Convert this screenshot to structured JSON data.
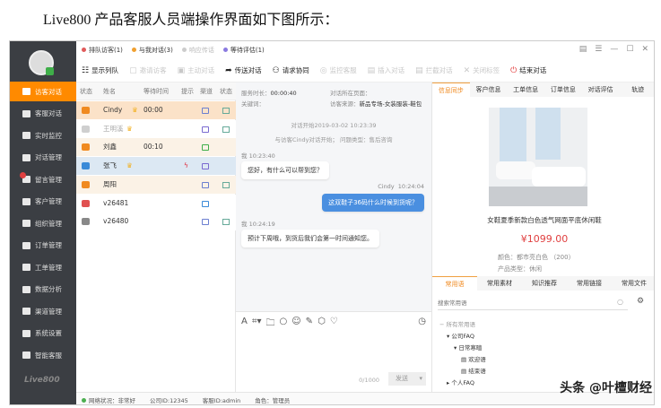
{
  "doc_title": "Live800 产品客服人员端操作界面如下图所示：",
  "sidebar": {
    "logo": "Live800",
    "items": [
      {
        "label": "访客对话",
        "active": true
      },
      {
        "label": "客服对话"
      },
      {
        "label": "实时监控"
      },
      {
        "label": "对话管理"
      },
      {
        "label": "留言管理",
        "badge": true
      },
      {
        "label": "客户管理"
      },
      {
        "label": "组织管理"
      },
      {
        "label": "订单管理"
      },
      {
        "label": "工单管理"
      },
      {
        "label": "数据分析"
      },
      {
        "label": "渠道管理"
      },
      {
        "label": "系统设置"
      },
      {
        "label": "智能客服"
      }
    ]
  },
  "queue_tabs": [
    {
      "label": "排队访客(1)",
      "color": "#e05a5a"
    },
    {
      "label": "与我对话(3)",
      "color": "#f0a030"
    },
    {
      "label": "响应传话",
      "color": "#cccccc"
    },
    {
      "label": "等待评估(1)",
      "color": "#8a7ae0"
    }
  ],
  "window_controls": [
    "▤",
    "☰",
    "—",
    "☐",
    "✕"
  ],
  "toolbar": [
    {
      "label": "显示列队",
      "icon": "list-icon",
      "icon_glyph": "☷"
    },
    {
      "label": "邀请访客",
      "disabled": true,
      "icon": "invite-icon",
      "icon_glyph": "▢"
    },
    {
      "label": "主动对话",
      "disabled": true,
      "icon": "chat-icon",
      "icon_glyph": "▣"
    },
    {
      "label": "传送对话",
      "icon": "forward-icon",
      "icon_glyph": "➦"
    },
    {
      "label": "请求协同",
      "icon": "add-user-icon",
      "icon_glyph": "⚇"
    },
    {
      "label": "监控客服",
      "disabled": true,
      "icon": "monitor-icon",
      "icon_glyph": "◎"
    },
    {
      "label": "插入对话",
      "disabled": true,
      "icon": "insert-icon",
      "icon_glyph": "▤"
    },
    {
      "label": "拦截对话",
      "disabled": true,
      "icon": "intercept-icon",
      "icon_glyph": "▤"
    },
    {
      "label": "关闭标签",
      "disabled": true,
      "icon": "close-icon",
      "icon_glyph": "✕"
    },
    {
      "label": "结束对话",
      "icon": "power-icon",
      "icon_glyph": "⏻",
      "color": "#e03030"
    }
  ],
  "list": {
    "headers": [
      "状态",
      "姓名",
      "等待时间",
      "提示",
      "渠道",
      "状态"
    ],
    "rows": [
      {
        "name": "Cindy",
        "vip": true,
        "wait": "00:00",
        "channel": "pc",
        "checked": true,
        "bg": "#fbe2c8",
        "status_color": "#f08a20"
      },
      {
        "name": "王明溪",
        "vip": true,
        "wait": "",
        "channel": "mobile",
        "checked": true,
        "bg": "#ffffff",
        "status_color": "#cfcfcf",
        "faded": true
      },
      {
        "name": "刘鑫",
        "vip": false,
        "wait": "00:10",
        "channel": "wechat",
        "checked": false,
        "bg": "#fbf2e6",
        "status_color": "#f08a20"
      },
      {
        "name": "张飞",
        "vip": true,
        "wait": "",
        "alert": true,
        "channel": "mobile",
        "checked": false,
        "bg": "#dce8f3",
        "status_color": "#3a8ad8"
      },
      {
        "name": "周阳",
        "vip": false,
        "wait": "",
        "channel": "pc",
        "checked": true,
        "bg": "#fbf2e6",
        "status_color": "#f08a20"
      },
      {
        "name": "v26481",
        "vip": false,
        "wait": "",
        "channel": "robot",
        "checked": false,
        "bg": "#ffffff",
        "status_color": "#e05050"
      },
      {
        "name": "v26480",
        "vip": false,
        "wait": "",
        "channel": "pc",
        "checked": true,
        "bg": "#ffffff",
        "status_color": "#888888"
      }
    ]
  },
  "chat": {
    "service_time_label": "服务时长：",
    "service_time": "00:00:40",
    "keyword_label": "关键词：",
    "page_label": "对话所在页面：",
    "source_label": "访客来源：",
    "source": "新品专场-女装服装-鞋包",
    "start": "对话开始2019-03-02 10:23:39",
    "start2": "与访客Cindy对话开始；  问题类型：售后咨询",
    "messages": [
      {
        "from": "我",
        "time": "10:23:40",
        "text": "您好，有什么可以帮到您？",
        "mine": false
      },
      {
        "from": "Cindy",
        "time": "10:24:04",
        "text": "这双鞋子36码什么时候到货呢？",
        "mine": true
      },
      {
        "from": "我",
        "time": "10:24:19",
        "text": "预计下周哦，到货后我们会第一时间通知您。",
        "mine": false
      }
    ],
    "counter": "0/1000",
    "send": "发送"
  },
  "right": {
    "tabs": [
      "信息同步",
      "客户信息",
      "工单信息",
      "订单信息",
      "对话评估",
      "轨迹"
    ],
    "active_tab": 0,
    "product": {
      "title": "女鞋夏季新款白色透气网面平底休闲鞋",
      "price": "¥1099.00",
      "color_label": "颜色：都市亮白色 （200）",
      "type_label": "产品类型：休闲"
    },
    "bottom_tabs": [
      "常用语",
      "常用素材",
      "知识推荐",
      "常用链接",
      "常用文件"
    ],
    "bottom_active": 0,
    "search_placeholder": "搜索常用语",
    "tree": [
      {
        "label": "所有常用语",
        "level": 0,
        "icon": "−"
      },
      {
        "label": "公司FAQ",
        "level": 1,
        "icon": "▾"
      },
      {
        "label": "日常寒暄",
        "level": 2,
        "icon": "▾"
      },
      {
        "label": "欢迎语",
        "level": 3,
        "icon": "▤"
      },
      {
        "label": "结束语",
        "level": 3,
        "icon": "▤"
      },
      {
        "label": "个人FAQ",
        "level": 1,
        "icon": "▸"
      }
    ]
  },
  "status": {
    "network": "网络状况：非常好",
    "company": "公司ID:12345",
    "agent": "客服ID:admin",
    "role": "角色：管理员"
  },
  "watermark": "头条 @叶檀财经"
}
